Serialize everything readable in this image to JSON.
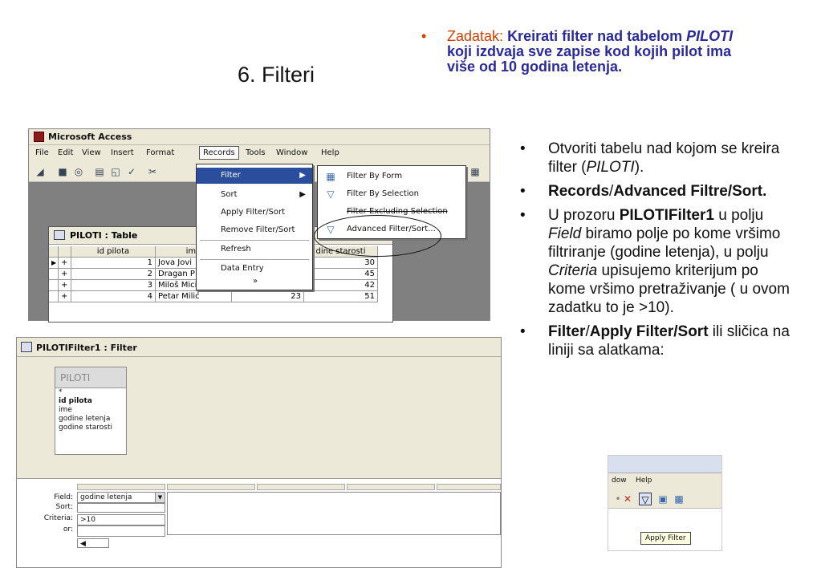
{
  "slide": {
    "title": "6. Filteri",
    "task": {
      "label": "Zadatak:",
      "text_1": "Kreirati filter nad tabelom",
      "text_table": "PILOTI",
      "text_2": "koji izdvaja sve zapise kod kojih pilot ima više od 10 godina letenja."
    }
  },
  "bullets": [
    {
      "plain_1": "Otvoriti tabelu nad kojom se kreira filter (",
      "italic": "PILOTI",
      "plain_2": ")."
    },
    {
      "bold_1": "Records",
      "plain_1": "/",
      "bold_2": "Advanced Filtre/Sort."
    },
    {
      "plain_1": "U prozoru ",
      "bold_1": "PILOTIFilter1",
      "plain_2": " u polju ",
      "italic_1": "Field",
      "plain_3": " biramo polje po kome vršimo filtriranje (godine letenja), u polju ",
      "italic_2": "Criteria",
      "plain_4": " upisujemo kriterijum po kome vršimo pretraživanje ( u ovom zadatku to je >10)."
    },
    {
      "bold_1": "Filter",
      "plain_1": "/",
      "bold_2": "Apply Filter/Sort",
      "plain_2": " ili sličica na liniji sa alatkama:"
    }
  ],
  "access": {
    "title": "Microsoft Access",
    "menu": [
      "File",
      "Edit",
      "View",
      "Insert",
      "Format",
      "Records",
      "Tools",
      "Window",
      "Help"
    ],
    "records_menu": [
      "Filter",
      "Sort",
      "Apply Filter/Sort",
      "Remove Filter/Sort",
      "Refresh",
      "Data Entry",
      "»"
    ],
    "filter_submenu": [
      "Filter By Form",
      "Filter By Selection",
      "Filter Excluding Selection",
      "Advanced Filter/Sort..."
    ],
    "table_window": {
      "title": "PILOTI : Table",
      "columns": [
        "id pilota",
        "ime",
        "dine starosti"
      ],
      "rows": [
        {
          "id": "1",
          "ime": "Jova Jovi",
          "col3": "",
          "age": "30"
        },
        {
          "id": "2",
          "ime": "Dragan P",
          "col3": "",
          "age": "45"
        },
        {
          "id": "3",
          "ime": "Miloš Micić",
          "col3": "10",
          "age": "42"
        },
        {
          "id": "4",
          "ime": "Petar Milić",
          "col3": "23",
          "age": "51"
        }
      ]
    }
  },
  "filter_window": {
    "title": "PILOTIFilter1 : Filter",
    "field_list": {
      "name": "PILOTI",
      "fields": [
        "*",
        "id pilota",
        "ime",
        "godine letenja",
        "godine starosti"
      ]
    },
    "grid": {
      "labels": [
        "Field:",
        "Sort:",
        "Criteria:",
        "or:"
      ],
      "field_value": "godine letenja",
      "criteria_value": ">10"
    }
  },
  "apply_inset": {
    "menu": [
      "dow",
      "Help"
    ],
    "tooltip": "Apply Filter"
  },
  "colors": {
    "task_label": "#d44000",
    "task_text": "#2a2a9a",
    "menu_highlight": "#2a4d9c",
    "window_bg": "#ece9d8"
  }
}
